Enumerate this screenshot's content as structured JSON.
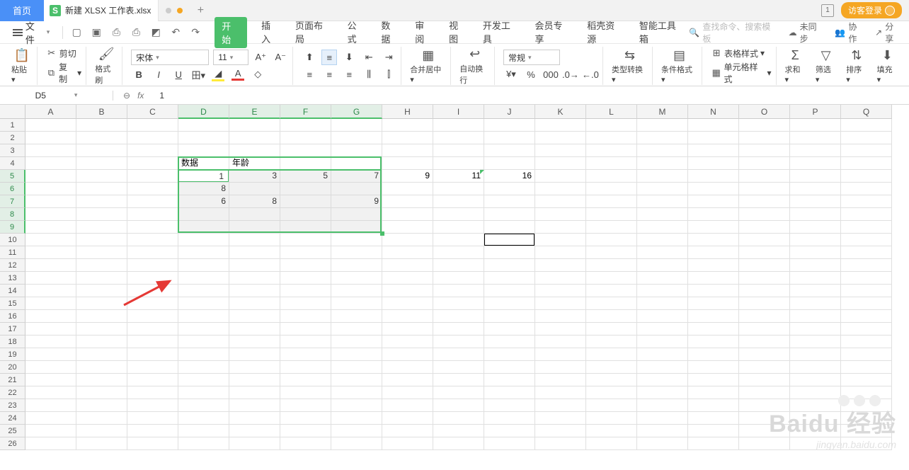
{
  "titlebar": {
    "home": "首页",
    "file_icon_letter": "S",
    "filename": "新建 XLSX 工作表.xlsx",
    "badge": "1",
    "login": "访客登录"
  },
  "menu": {
    "file": "文件",
    "tabs": [
      "开始",
      "插入",
      "页面布局",
      "公式",
      "数据",
      "审阅",
      "视图",
      "开发工具",
      "会员专享",
      "稻壳资源",
      "智能工具箱"
    ],
    "search_placeholder": "查找命令、搜索模板",
    "sync": "未同步",
    "collab": "协作",
    "share": "分享"
  },
  "ribbon": {
    "paste": "粘贴",
    "cut": "剪切",
    "copy": "复制",
    "format_painter": "格式刷",
    "font_name": "宋体",
    "font_size": "11",
    "merge_center": "合并居中",
    "auto_wrap": "自动换行",
    "number_format": "常规",
    "type_convert": "类型转换",
    "cond_fmt": "条件格式",
    "table_style": "表格样式",
    "cell_style": "单元格样式",
    "sum": "求和",
    "filter": "筛选",
    "sort": "排序",
    "fill": "填充"
  },
  "namebox": {
    "ref": "D5"
  },
  "formula": {
    "value": "1"
  },
  "columns": [
    "A",
    "B",
    "C",
    "D",
    "E",
    "F",
    "G",
    "H",
    "I",
    "J",
    "K",
    "L",
    "M",
    "N",
    "O",
    "P",
    "Q"
  ],
  "rows_count": 26,
  "selected_cols": [
    "D",
    "E",
    "F",
    "G"
  ],
  "selected_rows": [
    5,
    6,
    7,
    8,
    9
  ],
  "cell_data": {
    "D4": "数据",
    "E4": "年龄",
    "D5": "1",
    "E5": "3",
    "F5": "5",
    "G5": "7",
    "H5": "9",
    "I5": "11",
    "J5": "16",
    "D6": "8",
    "D7": "6",
    "E7": "8",
    "G7": "9"
  },
  "cursor_cell": "J10",
  "watermark": {
    "brand": "Baidu 经验",
    "url": "jingyan.baidu.com"
  }
}
